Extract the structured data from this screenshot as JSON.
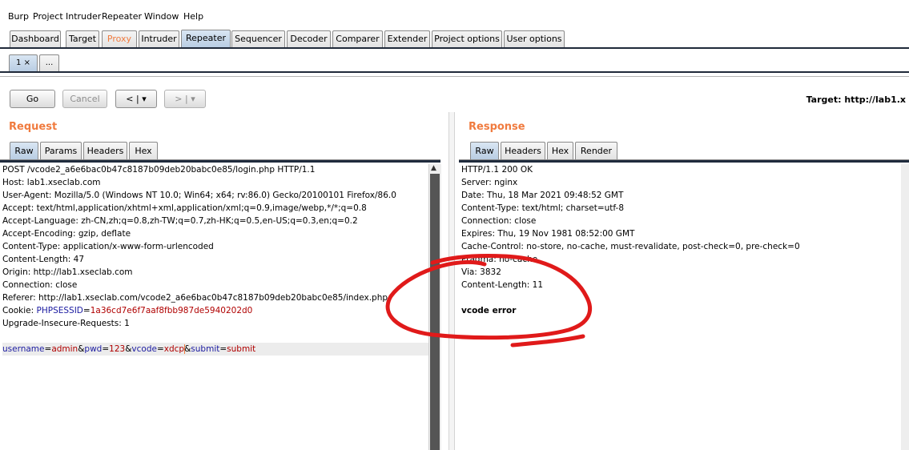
{
  "menubar": [
    "Burp",
    "Project",
    "Intruder",
    "Repeater",
    "Window",
    "Help"
  ],
  "main_tabs": [
    {
      "label": "Dashboard"
    },
    {
      "label": "Target"
    },
    {
      "label": "Proxy"
    },
    {
      "label": "Intruder"
    },
    {
      "label": "Repeater"
    },
    {
      "label": "Sequencer"
    },
    {
      "label": "Decoder"
    },
    {
      "label": "Comparer"
    },
    {
      "label": "Extender"
    },
    {
      "label": "Project options"
    },
    {
      "label": "User options"
    }
  ],
  "repeater_tabs": {
    "tab1": "1 ×",
    "more": "..."
  },
  "toolbar": {
    "go": "Go",
    "cancel": "Cancel",
    "prev": "< | ▾",
    "next": "> | ▾",
    "target": "Target: http://lab1.x"
  },
  "request": {
    "heading": "Request",
    "tabs": [
      "Raw",
      "Params",
      "Headers",
      "Hex"
    ],
    "lines": [
      "POST /vcode2_a6e6bac0b47c8187b09deb20babc0e85/login.php HTTP/1.1",
      "Host: lab1.xseclab.com",
      "User-Agent: Mozilla/5.0 (Windows NT 10.0; Win64; x64; rv:86.0) Gecko/20100101 Firefox/86.0",
      "Accept: text/html,application/xhtml+xml,application/xml;q=0.9,image/webp,*/*;q=0.8",
      "Accept-Language: zh-CN,zh;q=0.8,zh-TW;q=0.7,zh-HK;q=0.5,en-US;q=0.3,en;q=0.2",
      "Accept-Encoding: gzip, deflate",
      "Content-Type: application/x-www-form-urlencoded",
      "Content-Length: 47",
      "Origin: http://lab1.xseclab.com",
      "Connection: close",
      "Referer: http://lab1.xseclab.com/vcode2_a6e6bac0b47c8187b09deb20babc0e85/index.php"
    ],
    "cookie": {
      "label": "Cookie: ",
      "name": "PHPSESSID",
      "eq": "=",
      "value": "1a36cd7e6f7aaf8fbb987de5940202d0"
    },
    "upgrade": "Upgrade-Insecure-Requests: 1",
    "body": {
      "username_key": "username",
      "username_val": "admin",
      "pwd_key": "pwd",
      "pwd_val": "123",
      "vcode_key": "vcode",
      "vcode_val": "xdcp",
      "submit_key": "submit",
      "submit_val": "submit"
    }
  },
  "response": {
    "heading": "Response",
    "tabs": [
      "Raw",
      "Headers",
      "Hex",
      "Render"
    ],
    "lines": [
      "HTTP/1.1 200 OK",
      "Server: nginx",
      "Date: Thu, 18 Mar 2021 09:48:52 GMT",
      "Content-Type: text/html; charset=utf-8",
      "Connection: close",
      "Expires: Thu, 19 Nov 1981 08:52:00 GMT",
      "Cache-Control: no-store, no-cache, must-revalidate, post-check=0, pre-check=0",
      "Pragma: no-cache",
      "Via: 3832",
      "Content-Length: 11"
    ],
    "body": "vcode error"
  },
  "colors": {
    "accent": "#f07b3f",
    "annotation": "#e01a1a",
    "selected_tab": "#c4d6ea"
  }
}
